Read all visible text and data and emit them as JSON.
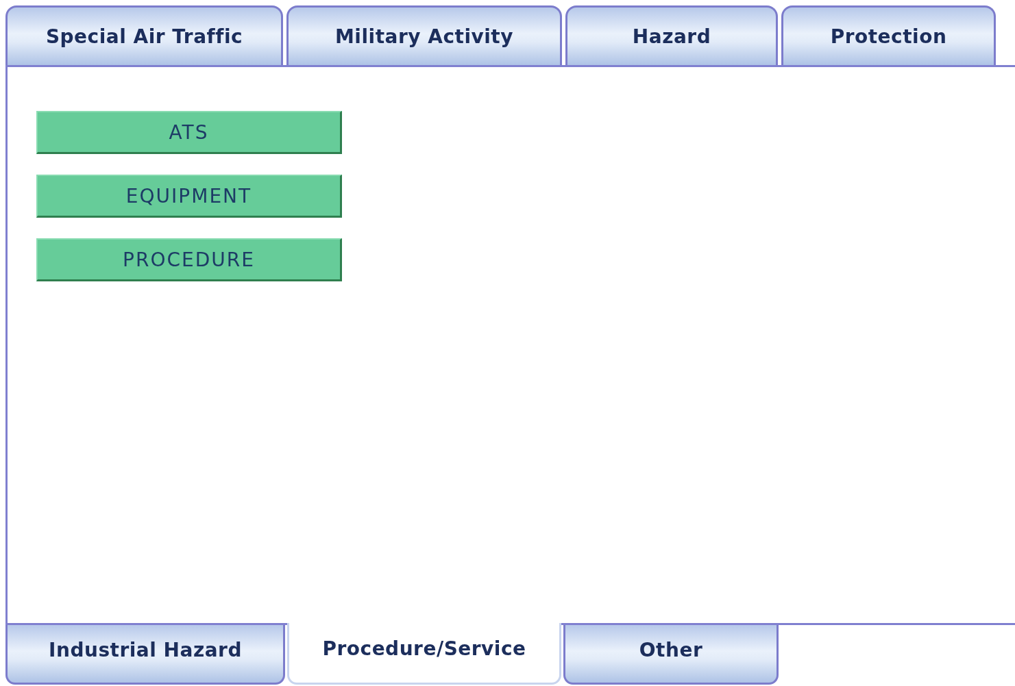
{
  "top_tabs": [
    {
      "label": "Special Air Traffic",
      "selected": false
    },
    {
      "label": "Military Activity",
      "selected": false
    },
    {
      "label": "Hazard",
      "selected": false
    },
    {
      "label": "Protection",
      "selected": false
    }
  ],
  "buttons": [
    "ATS",
    "EQUIPMENT",
    "PROCEDURE"
  ],
  "bottom_tabs": [
    {
      "label": "Industrial Hazard",
      "selected": false
    },
    {
      "label": "Procedure/Service",
      "selected": true
    },
    {
      "label": "Other",
      "selected": false
    }
  ]
}
